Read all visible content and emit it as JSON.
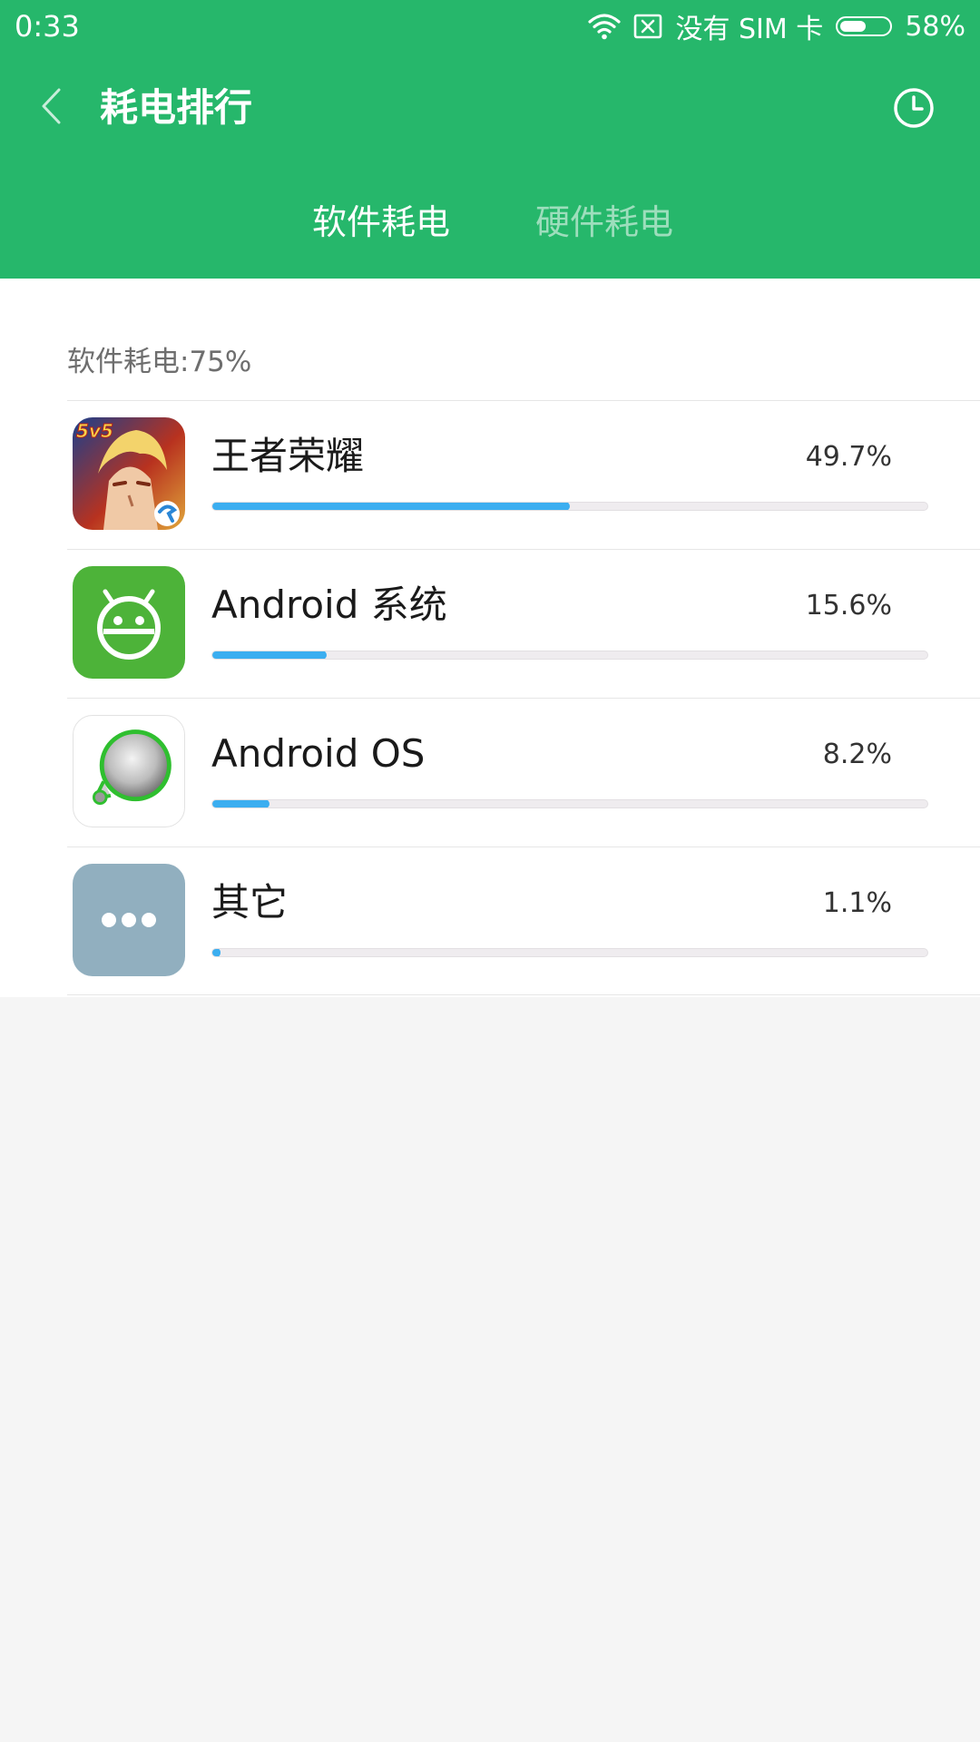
{
  "status_bar": {
    "time": "0:33",
    "carrier": "没有 SIM 卡",
    "battery": "58%",
    "battery_level": 0.58,
    "icons": [
      "wifi-icon",
      "no-sim-icon",
      "battery-icon"
    ]
  },
  "header": {
    "title": "耗电排行",
    "back_icon": "chevron-left-icon",
    "history_icon": "clock-icon"
  },
  "tabs": [
    {
      "label": "软件耗电",
      "active": true
    },
    {
      "label": "硬件耗电",
      "active": false
    }
  ],
  "section": {
    "label": "软件耗电:75%"
  },
  "apps": [
    {
      "name": "王者荣耀",
      "percent": "49.7%",
      "level": 0.5,
      "icon": "game-app-icon"
    },
    {
      "name": "Android 系统",
      "percent": "15.6%",
      "level": 0.16,
      "icon": "android-robot-icon"
    },
    {
      "name": "Android OS",
      "percent": "8.2%",
      "level": 0.08,
      "icon": "android-os-icon"
    },
    {
      "name": "其它",
      "percent": "1.1%",
      "level": 0.011,
      "icon": "more-dots-icon"
    }
  ],
  "colors": {
    "header": "#26b76b",
    "bar_fill": "#3baef0",
    "bar_track": "#efecef",
    "background": "#f5f5f5",
    "android_green": "#4db339",
    "other_icon_bg": "#91afbf"
  }
}
